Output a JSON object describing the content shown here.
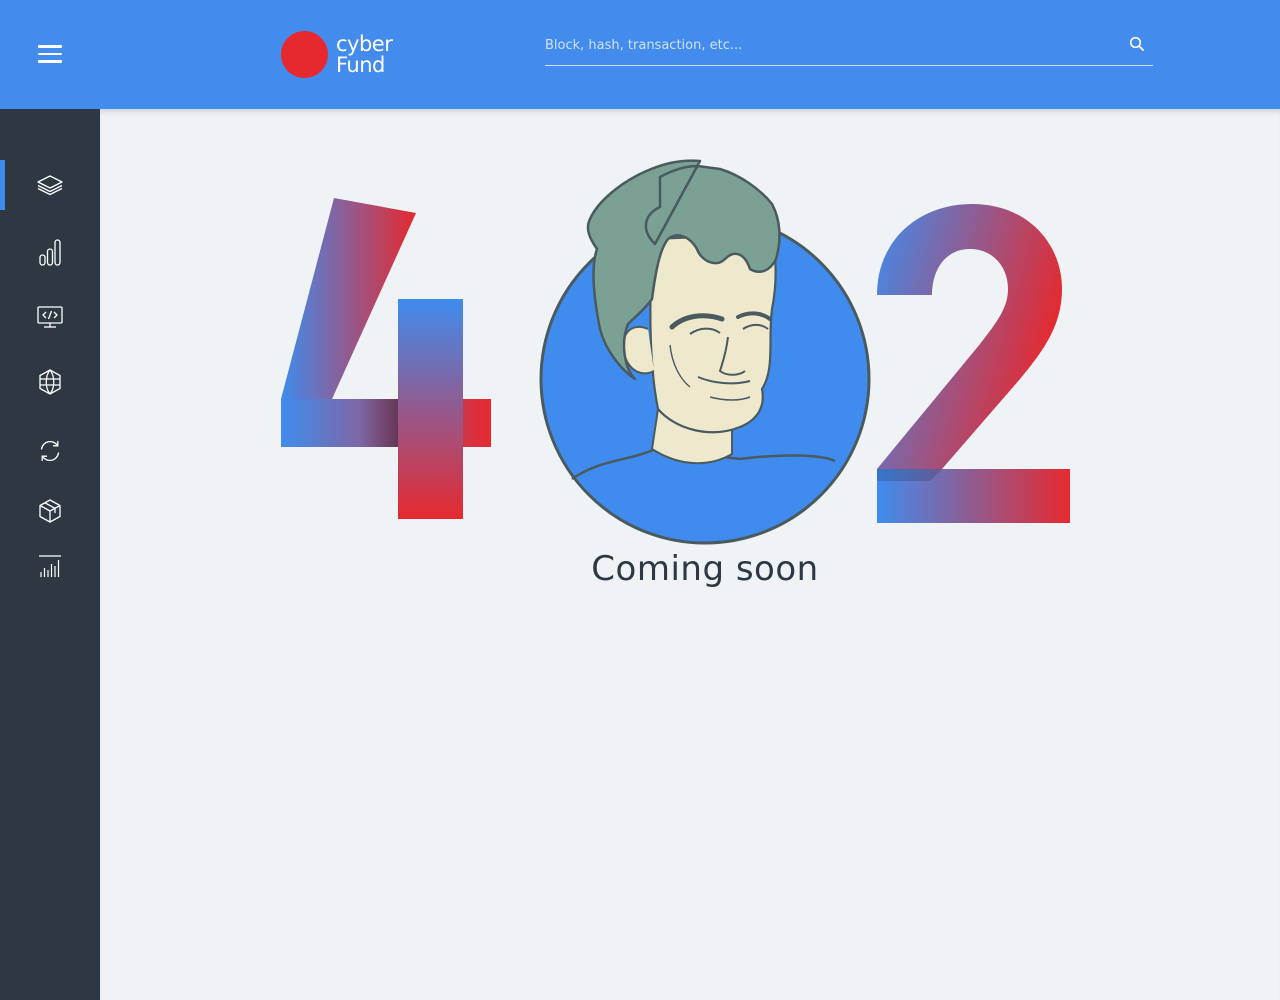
{
  "header": {
    "menu_icon": "hamburger-menu-icon",
    "logo": {
      "line1": "cyber",
      "line2": "Fund",
      "dot_color": "#e6292f"
    },
    "search": {
      "placeholder": "Block, hash, transaction, etc...",
      "value": "",
      "icon": "search-icon"
    },
    "background_color": "#438ced"
  },
  "sidebar": {
    "background_color": "#2e3843",
    "active_color": "#3f8cee",
    "items": [
      {
        "icon": "layers-icon",
        "active": true
      },
      {
        "icon": "bar-chart-icon",
        "active": false
      },
      {
        "icon": "code-monitor-icon",
        "active": false
      },
      {
        "icon": "globe-network-icon",
        "active": false
      },
      {
        "icon": "sync-icon",
        "active": false
      },
      {
        "icon": "cube-icon",
        "active": false
      },
      {
        "icon": "chart-bars-icon",
        "active": false
      }
    ]
  },
  "main": {
    "error_code": "402",
    "message": "Coming soon",
    "illustration": "cartoon-portrait-in-circle",
    "gradient_colors": [
      "#3f8cee",
      "#e6292f"
    ]
  }
}
